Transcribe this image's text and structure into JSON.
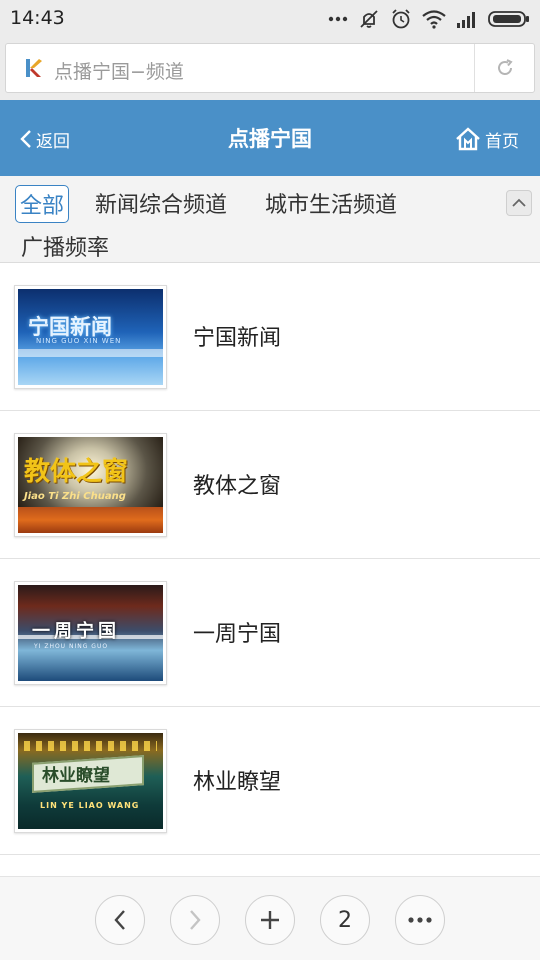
{
  "status_bar": {
    "time": "14:43"
  },
  "browser": {
    "url_text": "点播宁国−频道"
  },
  "header": {
    "back_label": "返回",
    "title": "点播宁国",
    "home_label": "首页"
  },
  "categories": [
    {
      "label": "全部",
      "active": true
    },
    {
      "label": "新闻综合频道",
      "active": false
    },
    {
      "label": "城市生活频道",
      "active": false
    },
    {
      "label": "广播频率",
      "active": false
    }
  ],
  "programs": [
    {
      "title": "宁国新闻",
      "thumb_caption": "宁国新闻",
      "thumb_subcaption": "NING GUO XIN WEN"
    },
    {
      "title": "教体之窗",
      "thumb_caption": "教体之窗",
      "thumb_subcaption": "Jiao Ti Zhi Chuang"
    },
    {
      "title": "一周宁国",
      "thumb_caption": "一周宁国",
      "thumb_subcaption": "YI ZHOU NING GUO"
    },
    {
      "title": "林业瞭望",
      "thumb_caption": "林业瞭望",
      "thumb_subcaption": "LIN YE LIAO WANG"
    }
  ],
  "bottom_nav": {
    "tab_count": "2"
  },
  "colors": {
    "header_blue": "#4a90c8",
    "active_tab": "#3a83c4"
  }
}
